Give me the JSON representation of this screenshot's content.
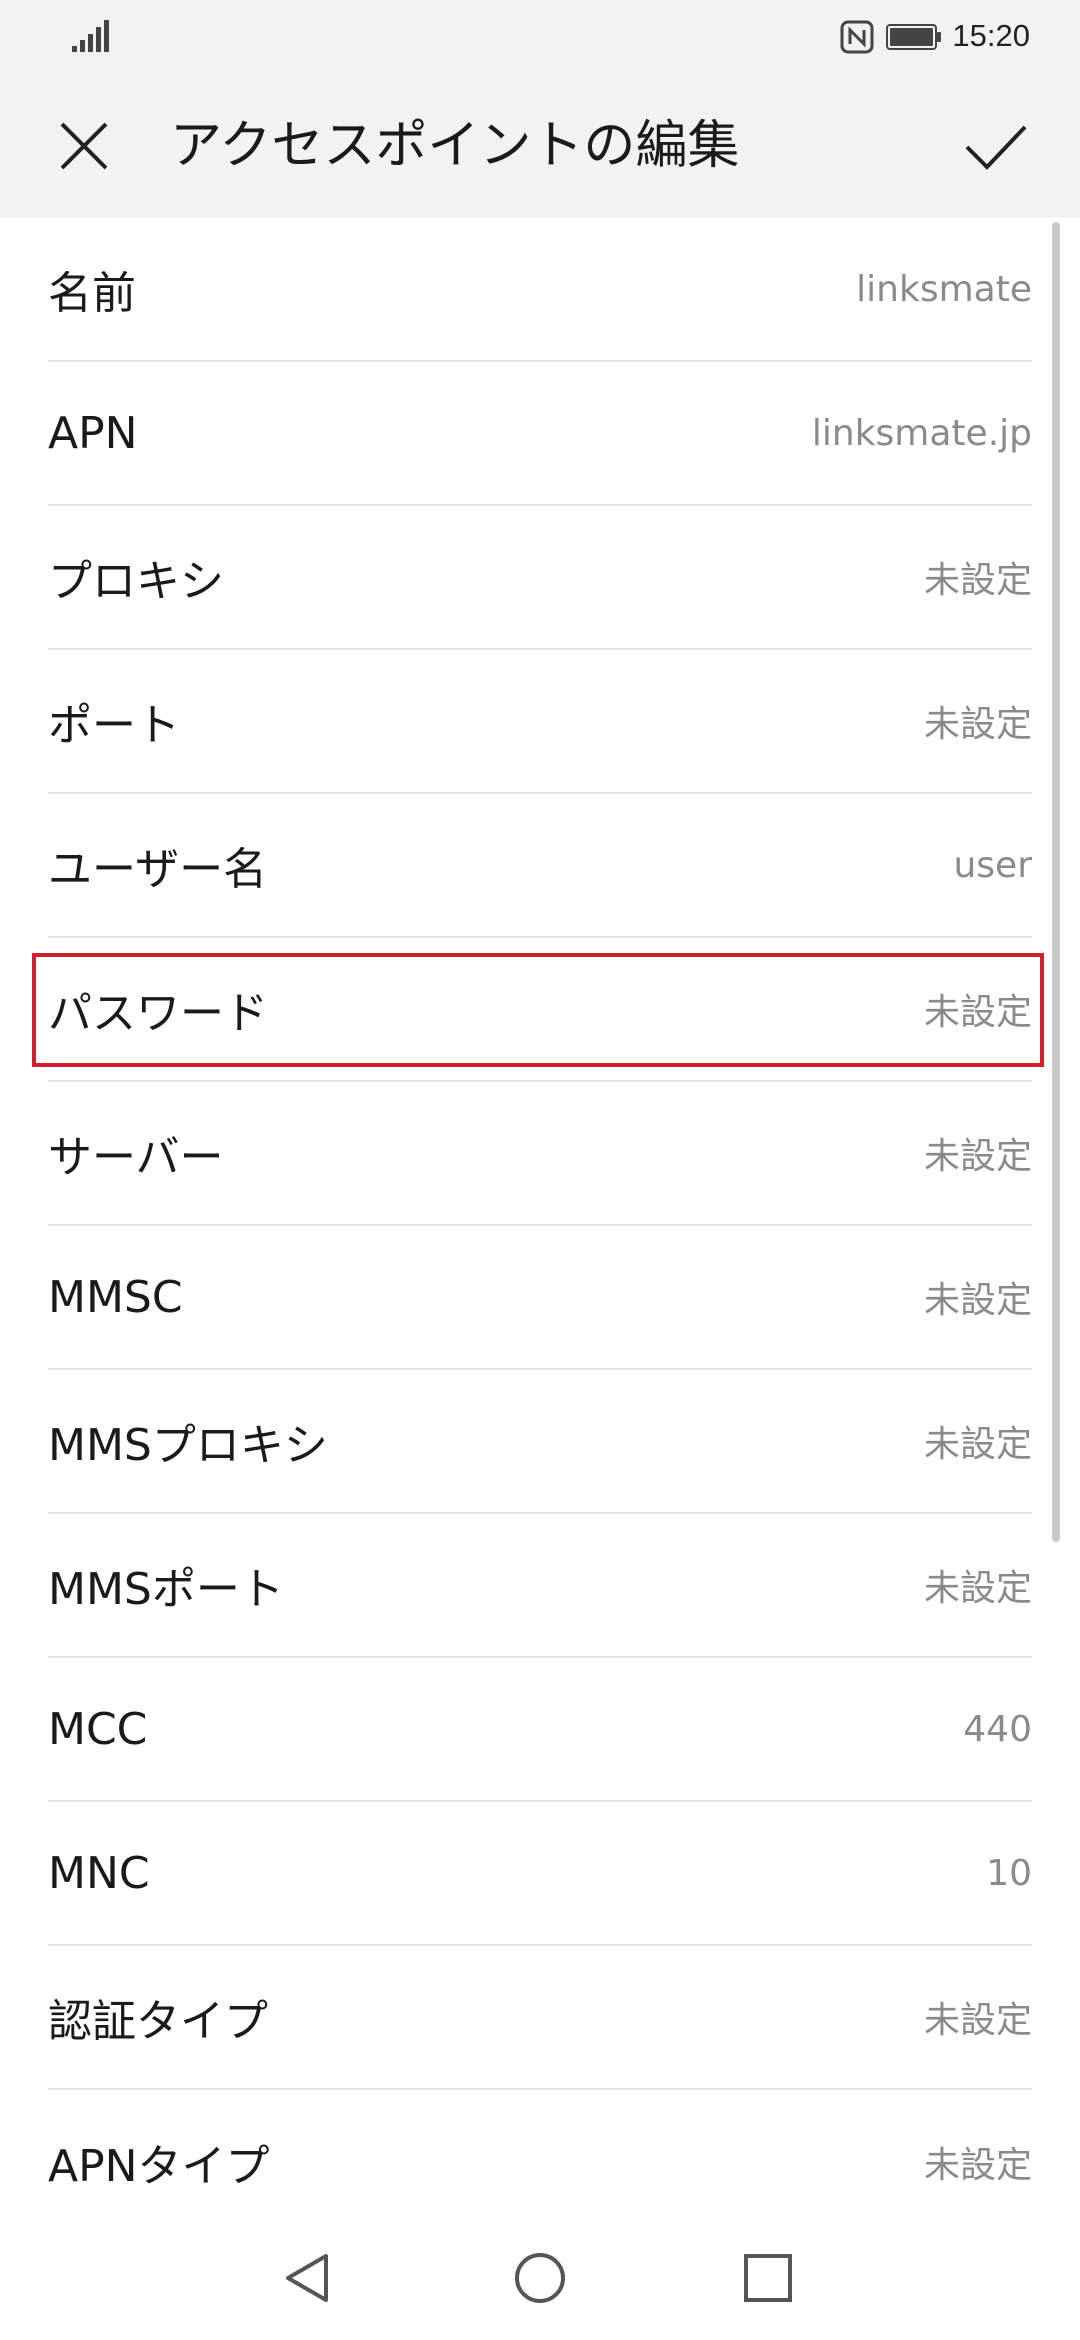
{
  "status_bar": {
    "time": "15:20",
    "icons": [
      "signal-icon",
      "nfc-icon",
      "battery-icon"
    ]
  },
  "header": {
    "title": "アクセスポイントの編集",
    "close_icon": "close-icon",
    "confirm_icon": "check-icon"
  },
  "fields": [
    {
      "label": "名前",
      "value": "linksmate"
    },
    {
      "label": "APN",
      "value": "linksmate.jp"
    },
    {
      "label": "プロキシ",
      "value": "未設定"
    },
    {
      "label": "ポート",
      "value": "未設定"
    },
    {
      "label": "ユーザー名",
      "value": "user"
    },
    {
      "label": "パスワード",
      "value": "未設定"
    },
    {
      "label": "サーバー",
      "value": "未設定"
    },
    {
      "label": "MMSC",
      "value": "未設定"
    },
    {
      "label": "MMSプロキシ",
      "value": "未設定"
    },
    {
      "label": "MMSポート",
      "value": "未設定"
    },
    {
      "label": "MCC",
      "value": "440"
    },
    {
      "label": "MNC",
      "value": "10"
    },
    {
      "label": "認証タイプ",
      "value": "未設定"
    },
    {
      "label": "APNタイプ",
      "value": "未設定"
    }
  ],
  "highlighted_field": "パスワード",
  "colors": {
    "highlight_border": "#d21f2b",
    "header_bg": "#f2f2f2",
    "value_text": "#8a8a8a"
  },
  "nav_bar": {
    "icons": [
      "back-icon",
      "home-icon",
      "recents-icon"
    ]
  }
}
